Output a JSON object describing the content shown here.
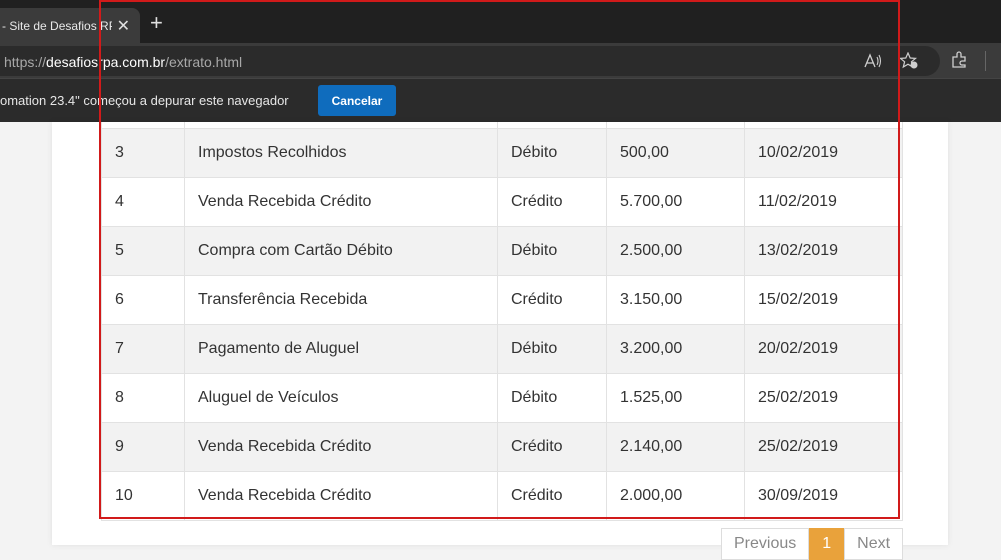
{
  "browser": {
    "tab_title": "- Site de Desafios RPA",
    "tab_close": "✕",
    "new_tab": "+",
    "url_scheme": "https://",
    "url_host": "desafiosrpa.com.br",
    "url_path": "/extrato.html",
    "infobar_text": "omation 23.4\" começou a depurar este navegador",
    "cancel_label": "Cancelar"
  },
  "table": {
    "rows": [
      {
        "id": "3",
        "descricao": "Impostos Recolhidos",
        "tipo": "Débito",
        "valor": "500,00",
        "data": "10/02/2019"
      },
      {
        "id": "4",
        "descricao": "Venda Recebida Crédito",
        "tipo": "Crédito",
        "valor": "5.700,00",
        "data": "11/02/2019"
      },
      {
        "id": "5",
        "descricao": "Compra com Cartão Débito",
        "tipo": "Débito",
        "valor": "2.500,00",
        "data": "13/02/2019"
      },
      {
        "id": "6",
        "descricao": "Transferência Recebida",
        "tipo": "Crédito",
        "valor": "3.150,00",
        "data": "15/02/2019"
      },
      {
        "id": "7",
        "descricao": "Pagamento de Aluguel",
        "tipo": "Débito",
        "valor": "3.200,00",
        "data": "20/02/2019"
      },
      {
        "id": "8",
        "descricao": "Aluguel de Veículos",
        "tipo": "Débito",
        "valor": "1.525,00",
        "data": "25/02/2019"
      },
      {
        "id": "9",
        "descricao": "Venda Recebida Crédito",
        "tipo": "Crédito",
        "valor": "2.140,00",
        "data": "25/02/2019"
      },
      {
        "id": "10",
        "descricao": "Venda Recebida Crédito",
        "tipo": "Crédito",
        "valor": "2.000,00",
        "data": "30/09/2019"
      }
    ]
  },
  "pagination": {
    "previous": "Previous",
    "current": "1",
    "next": "Next"
  },
  "colors": {
    "highlight": "#d11a1a",
    "cancel_button": "#0f6cbd",
    "active_page": "#e9a23b"
  }
}
